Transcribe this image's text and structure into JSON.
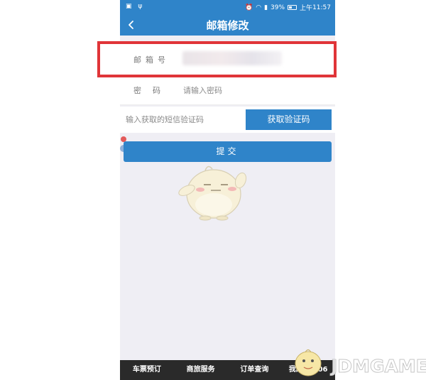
{
  "status_bar": {
    "battery": "39%",
    "time_prefix": "上午",
    "time": "11:57"
  },
  "nav": {
    "title": "邮箱修改"
  },
  "form": {
    "email_label": "邮箱号",
    "password_label": "密码",
    "password_placeholder": "请输入密码",
    "sms_placeholder": "输入获取的短信验证码",
    "sms_button": "获取验证码",
    "submit": "提交"
  },
  "tabs": [
    {
      "label": "车票预订"
    },
    {
      "label": "商旅服务"
    },
    {
      "label": "订单查询"
    },
    {
      "label": "我的12306"
    }
  ],
  "watermark": "JDMGAME",
  "colors": {
    "primary": "#2f84c9",
    "highlight": "#e03438",
    "tab_bar": "#2a2a2a",
    "page_bg": "#efeef4"
  }
}
